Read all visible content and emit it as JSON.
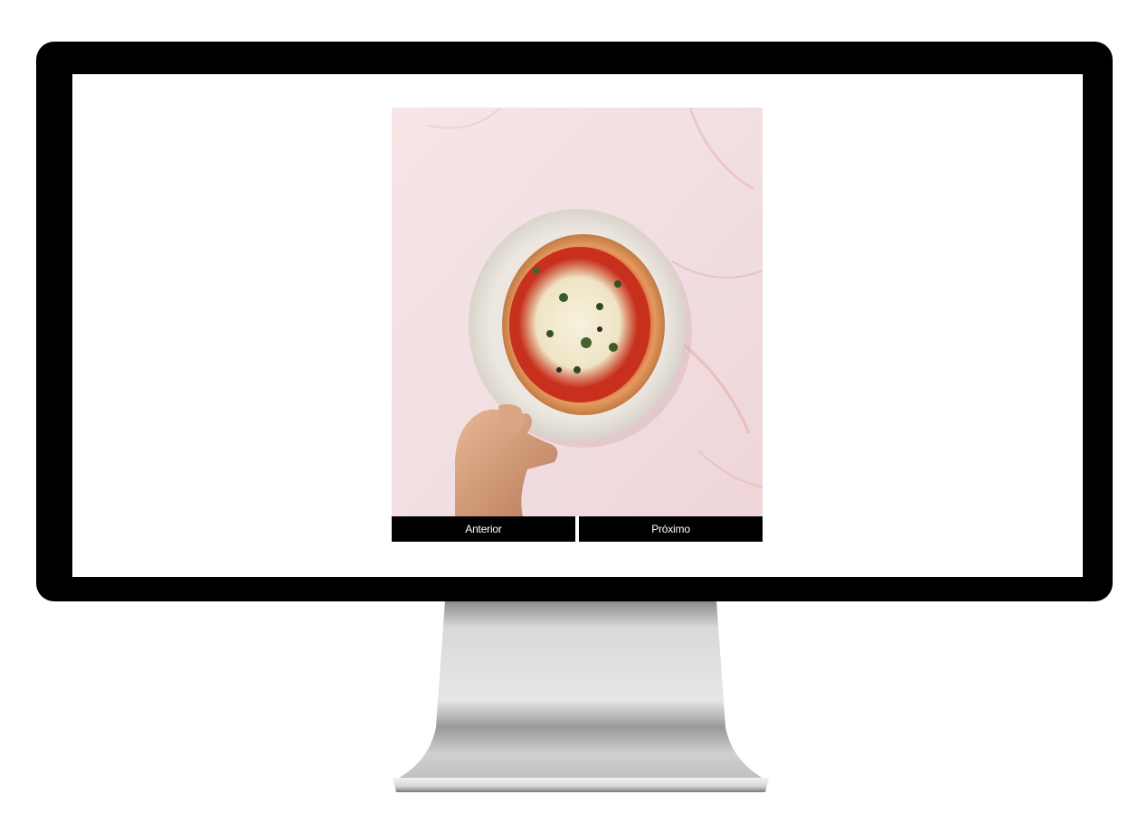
{
  "gallery": {
    "image": {
      "subject": "pizza-on-ceramic-plate-held-by-hand"
    },
    "prev_label": "Anterior",
    "next_label": "Próximo"
  },
  "colors": {
    "bezel": "#000000",
    "screen": "#ffffff",
    "button_bg": "#000000",
    "button_text": "#ffffff",
    "backdrop_pink": "#f3dede",
    "stand_silver": "#c8c8c8"
  }
}
